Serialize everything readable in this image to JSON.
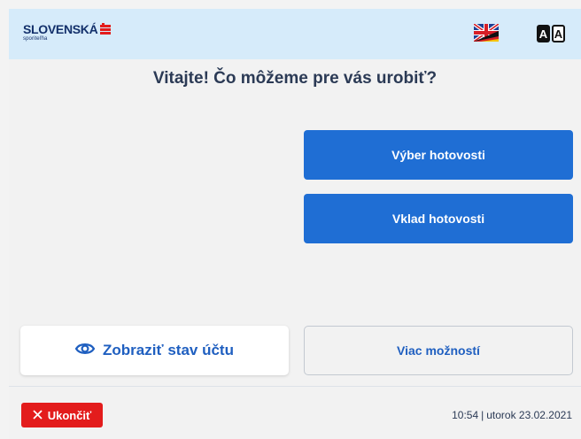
{
  "header": {
    "bank_name": "SLOVENSKÁ",
    "bank_sub": "sporiteľňa",
    "language_icon": "uk-flag-icon",
    "accessibility_left": "A",
    "accessibility_right": "A"
  },
  "main": {
    "title": "Vitajte! Čo môžeme pre vás urobiť?",
    "actions": [
      {
        "label": "Výber hotovosti"
      },
      {
        "label": "Vklad hotovosti"
      }
    ],
    "balance_label": "Zobraziť stav účtu",
    "balance_icon": "eye-icon",
    "more_label": "Viac možností"
  },
  "footer": {
    "exit_label": "Ukončiť",
    "exit_icon": "close-icon",
    "time": "10:54",
    "date": "utorok 23.02.2021"
  },
  "colors": {
    "header_bg": "#d6ebfa",
    "primary": "#1f6ed4",
    "exit": "#e31c1c",
    "brand_red": "#e31c1c",
    "brand_blue": "#13306b"
  }
}
